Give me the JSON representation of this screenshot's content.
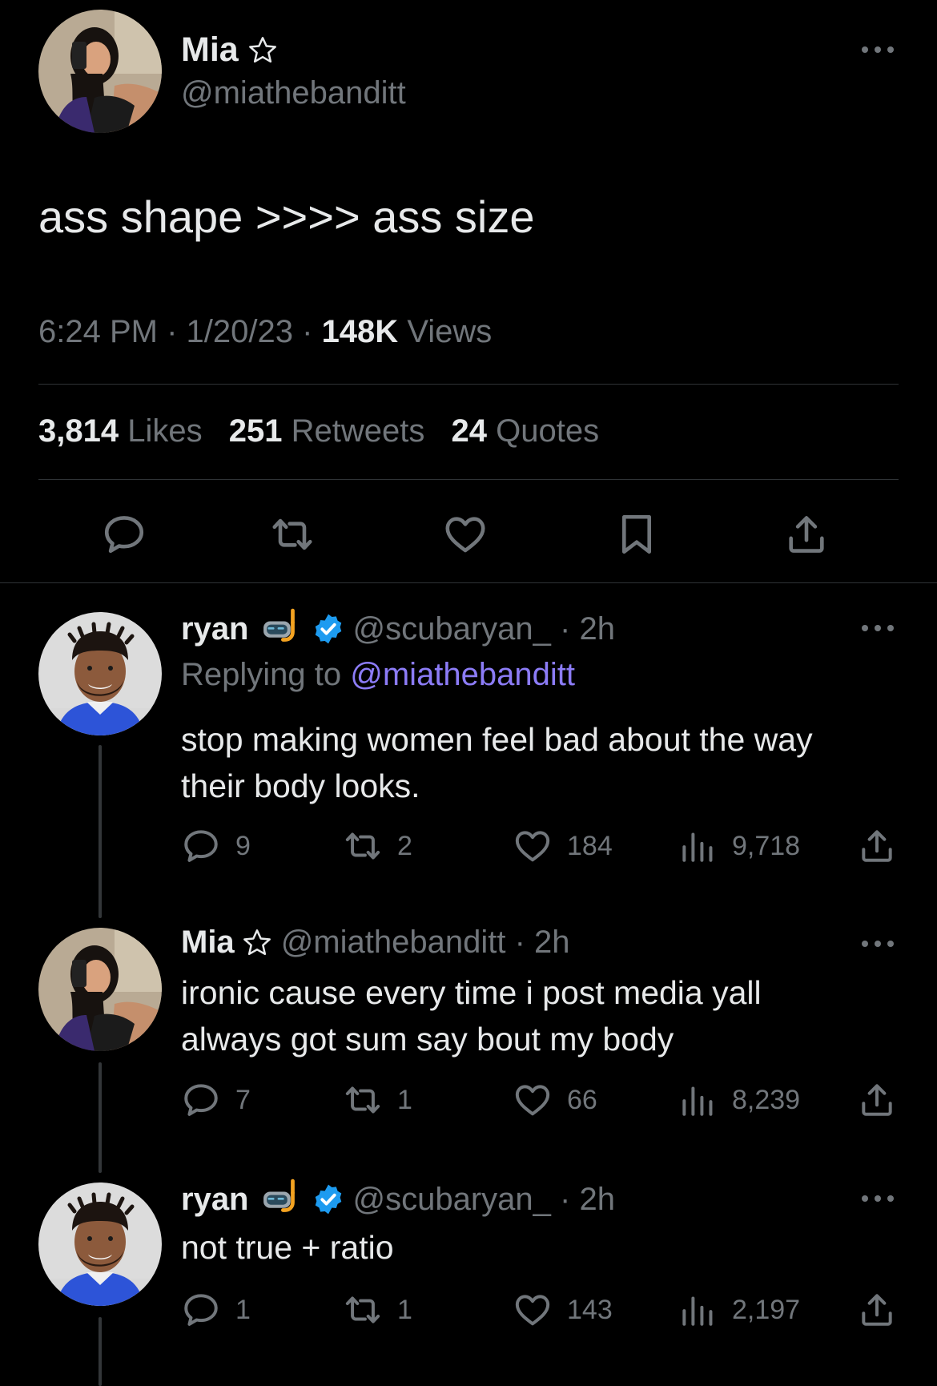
{
  "main_tweet": {
    "author": {
      "name": "Mia",
      "handle": "@miathebanditt"
    },
    "text": "ass shape >>>> ass size",
    "time": "6:24 PM",
    "date": "1/20/23",
    "views_count": "148K",
    "views_label": "Views",
    "stats": [
      {
        "count": "3,814",
        "label": "Likes"
      },
      {
        "count": "251",
        "label": "Retweets"
      },
      {
        "count": "24",
        "label": "Quotes"
      }
    ]
  },
  "replies": [
    {
      "name": "ryan",
      "handle": "@scubaryan_",
      "age": "2h",
      "replying_prefix": "Replying to",
      "replying_handle": "@miathebanditt",
      "lines": [
        "stop making women feel bad about the way",
        "their body looks."
      ],
      "replies": "9",
      "retweets": "2",
      "likes": "184",
      "views": "9,718"
    },
    {
      "name": "Mia",
      "handle": "@miathebanditt",
      "age": "2h",
      "lines": [
        "ironic cause every time i post media yall",
        "always got sum say bout my body"
      ],
      "replies": "7",
      "retweets": "1",
      "likes": "66",
      "views": "8,239"
    },
    {
      "name": "ryan",
      "handle": "@scubaryan_",
      "age": "2h",
      "lines": [
        "not true + ratio"
      ],
      "replies": "1",
      "retweets": "1",
      "likes": "143",
      "views": "2,197"
    }
  ],
  "icons": [
    "star-icon",
    "verified-badge-icon",
    "scuba-mask-emoji",
    "more-icon",
    "reply-icon",
    "retweet-icon",
    "like-icon",
    "bookmark-icon",
    "share-icon",
    "views-icon"
  ],
  "colors": {
    "background": "#000000",
    "text": "#e7e9ea",
    "muted": "#71767b",
    "link": "#8c7cf7",
    "verified": "#1d9bf0",
    "divider": "#2f3336"
  }
}
